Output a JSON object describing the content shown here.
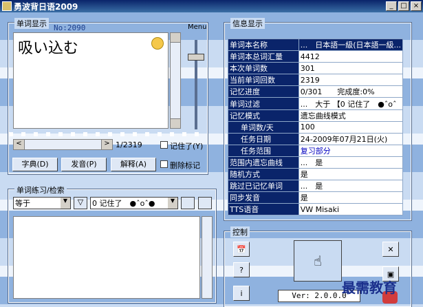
{
  "window": {
    "title": "勇波背日语2009",
    "min": "_",
    "max": "□",
    "close": "×"
  },
  "word_panel": {
    "title": "单词显示",
    "number": "No:2090",
    "word": "吸い込む",
    "menu_label": "Menu",
    "position": "1/2319",
    "remembered_label": "记住了(Y)",
    "delete_mark_label": "删除标记",
    "dict_button": "字典(D)",
    "speak_button": "发音(P)",
    "explain_button": "解释(A)"
  },
  "practice_panel": {
    "title": "单词练习/检索",
    "filter_mode": "等于",
    "filter_value": "0 记住了　●ˆoˆ●"
  },
  "info_panel": {
    "title": "信息显示",
    "rows": [
      {
        "key": "单词本名称",
        "value": "...　日本語一級(日本語一級..."
      },
      {
        "key": "单词本总词汇量",
        "value": "4412"
      },
      {
        "key": "本次单词数",
        "value": "301"
      },
      {
        "key": "当前单词回数",
        "value": "2319"
      },
      {
        "key": "记忆进度",
        "value": "0/301　　完成度:0%"
      },
      {
        "key": "单词过滤",
        "value": "...　大于 【0 记住了　●ˆoˆ"
      },
      {
        "key": "记忆模式",
        "value": "遗忘曲线模式"
      },
      {
        "key": "单词数/天",
        "value": "100"
      },
      {
        "key": "任务日期",
        "value": "24-2009年07月21日(火)"
      },
      {
        "key": "任务范围",
        "value": "复习部分"
      },
      {
        "key": "范围内遗忘曲线",
        "value": "...　是"
      },
      {
        "key": "随机方式",
        "value": "是"
      },
      {
        "key": "跳过已记忆单词",
        "value": "...　是"
      },
      {
        "key": "同步发音",
        "value": "是"
      },
      {
        "key": "TTS语音",
        "value": "VW Misaki"
      }
    ]
  },
  "control_panel": {
    "title": "控制",
    "version": "Ver: 2.0.0.0"
  },
  "watermark": "最需教育",
  "colors": {
    "title_bar": "#0a246a",
    "highlight": "#0a246a",
    "link_blue": "#0000c0"
  }
}
